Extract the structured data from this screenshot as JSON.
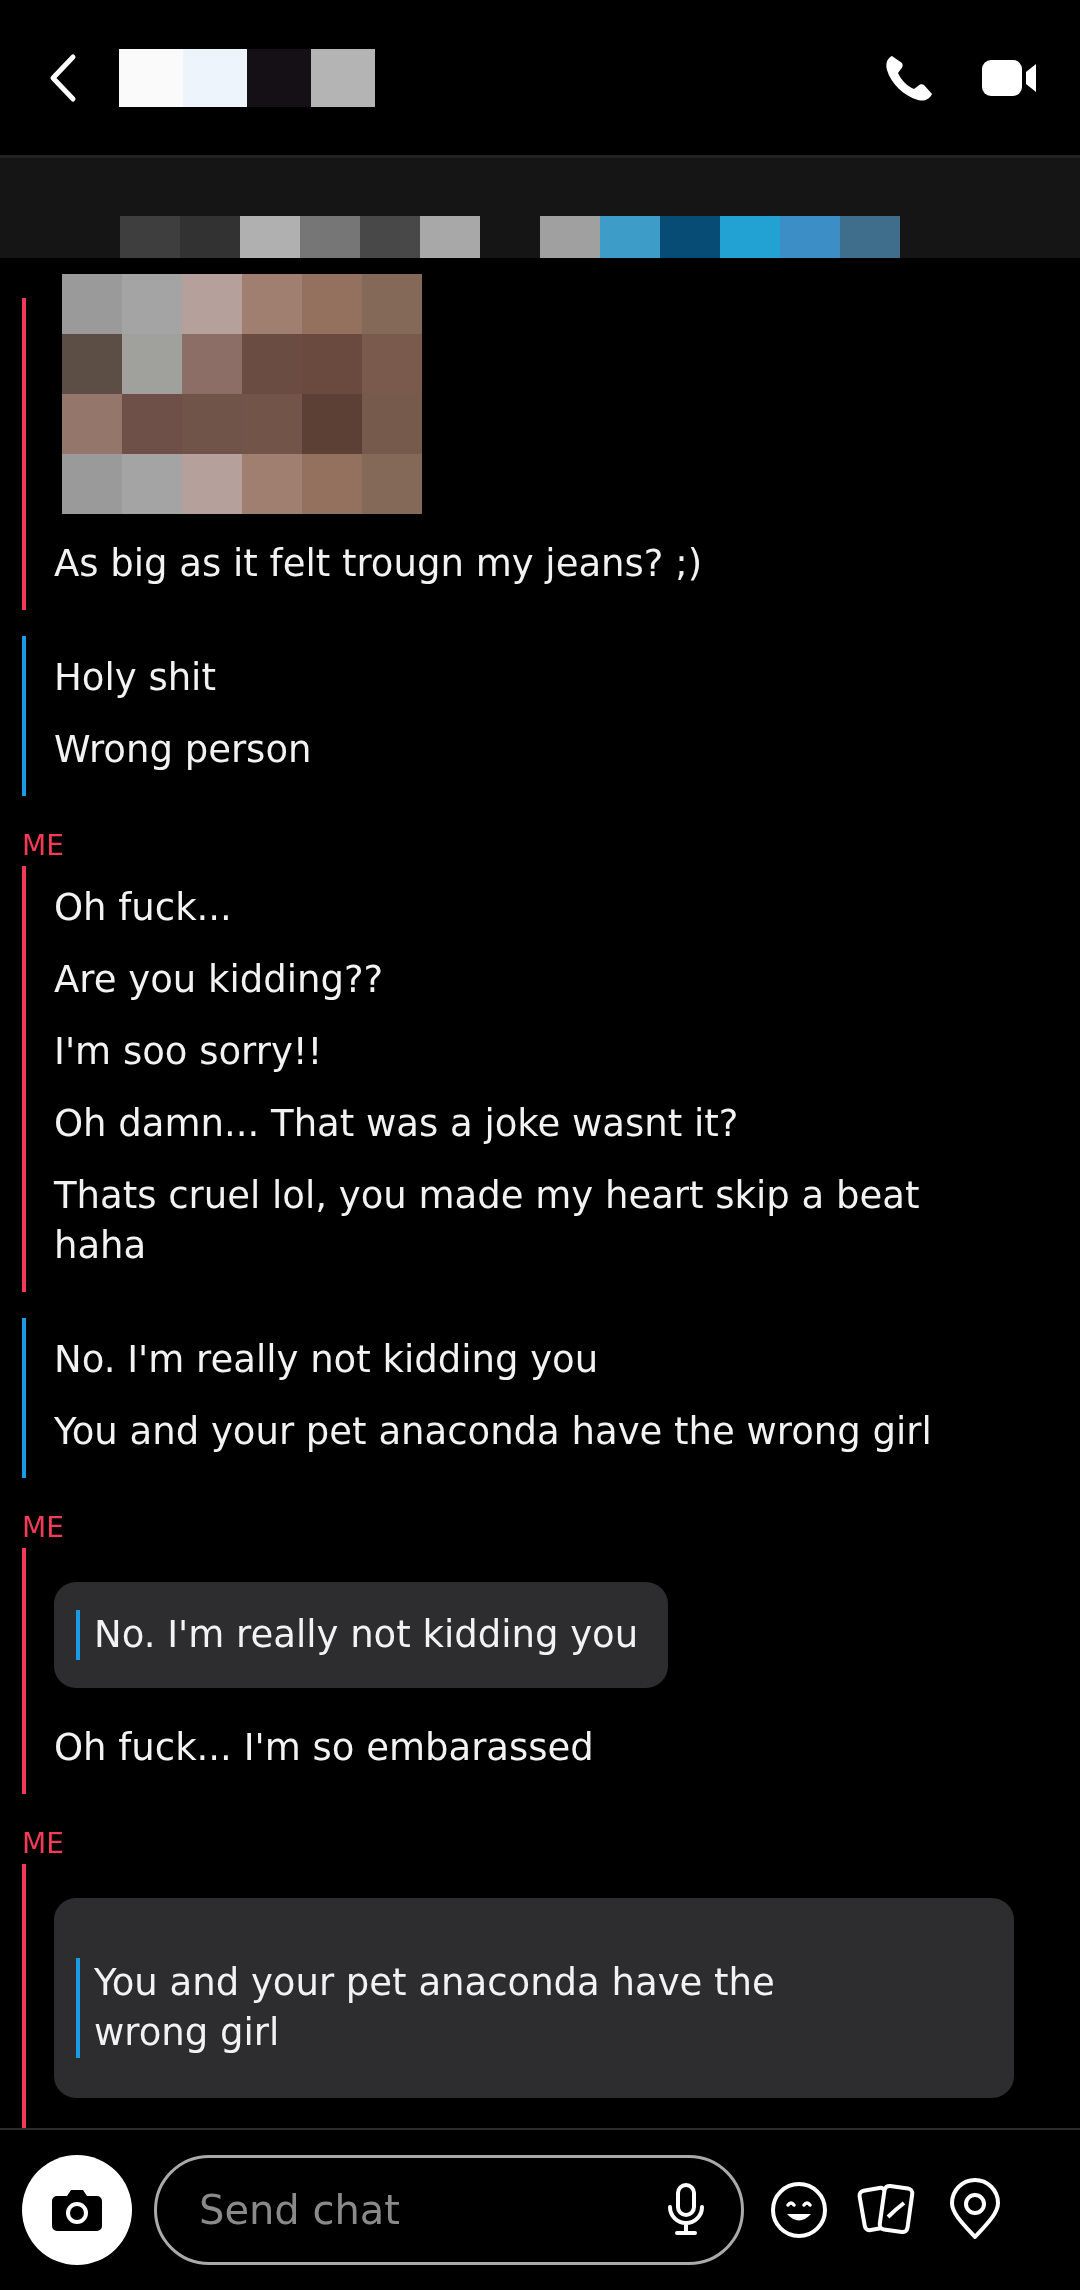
{
  "sections": [
    {
      "color": "#f23c57",
      "messages": [
        {
          "kind": "picture"
        },
        {
          "kind": "text",
          "text": "As big as it felt trougn my jeans? ;)"
        }
      ]
    },
    {
      "color": "#1a9be6",
      "messages": [
        {
          "kind": "text",
          "text": "Holy shit"
        },
        {
          "kind": "text",
          "text": "Wrong person"
        }
      ]
    },
    {
      "color": "#f23c57",
      "label": "ME",
      "messages": [
        {
          "kind": "text",
          "text": "Oh fuck..."
        },
        {
          "kind": "text",
          "text": "Are you kidding??"
        },
        {
          "kind": "text",
          "text": "I'm soo sorry!!"
        },
        {
          "kind": "text",
          "text": "Oh damn... That was a joke wasnt it?"
        },
        {
          "kind": "text",
          "text": "Thats cruel lol, you made my heart skip a beat haha"
        }
      ]
    },
    {
      "color": "#1a9be6",
      "messages": [
        {
          "kind": "text",
          "text": "No. I'm really not kidding you"
        },
        {
          "kind": "text",
          "text": "You and your pet anaconda have the wrong girl"
        }
      ]
    },
    {
      "color": "#f23c57",
      "label": "ME",
      "messages": [
        {
          "kind": "quote",
          "text": "No. I'm really not kidding you"
        },
        {
          "kind": "text",
          "text": "Oh fuck... I'm so embarassed"
        }
      ]
    },
    {
      "color": "#f23c57",
      "label": "ME",
      "messages": [
        {
          "kind": "quote",
          "text": "You and your pet anaconda have the wrong girl"
        }
      ]
    }
  ],
  "composer": {
    "placeholder": "Send chat"
  }
}
